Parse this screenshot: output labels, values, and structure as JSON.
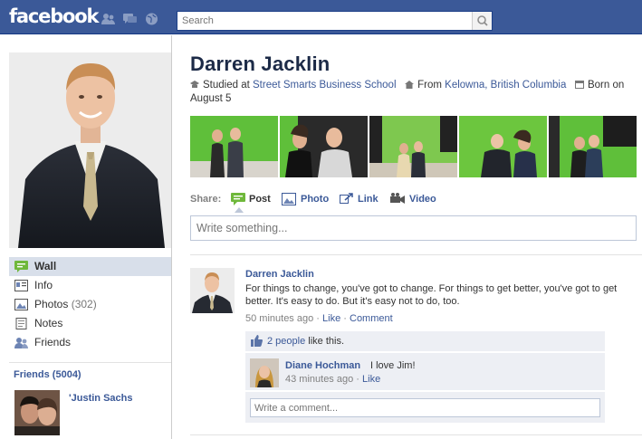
{
  "topbar": {
    "logo": "facebook",
    "search_placeholder": "Search",
    "icons": [
      "friend-requests-icon",
      "messages-icon",
      "notifications-globe-icon"
    ]
  },
  "profile": {
    "name": "Darren Jacklin",
    "studied_label": "Studied at",
    "school": "Street Smarts Business School",
    "from_label": "From",
    "hometown": "Kelowna, British Columbia",
    "born_label": "Born on",
    "born_date": "August 5"
  },
  "nav": {
    "items": [
      {
        "label": "Wall",
        "icon": "wall-icon"
      },
      {
        "label": "Info",
        "icon": "info-icon"
      },
      {
        "label": "Photos",
        "count": "(302)",
        "icon": "photos-icon"
      },
      {
        "label": "Notes",
        "icon": "notes-icon"
      },
      {
        "label": "Friends",
        "icon": "friends-icon"
      }
    ]
  },
  "friends": {
    "heading": "Friends",
    "count": "(5004)",
    "first_friend": "'Justin Sachs"
  },
  "share": {
    "label": "Share:",
    "items": [
      {
        "label": "Post",
        "icon": "post-icon"
      },
      {
        "label": "Photo",
        "icon": "photo-icon"
      },
      {
        "label": "Link",
        "icon": "link-icon"
      },
      {
        "label": "Video",
        "icon": "video-icon"
      }
    ],
    "composer_placeholder": "Write something..."
  },
  "story": {
    "author": "Darren Jacklin",
    "text": "For things to change, you've got to change. For things to get better, you've got to get better. It's easy to do. But it's easy not to do, too.",
    "time": "50 minutes ago",
    "sep": "·",
    "like": "Like",
    "comment": "Comment",
    "likes_link": "2 people",
    "likes_suffix": "like this.",
    "comments": [
      {
        "author": "Diane Hochman",
        "text": "I love Jim!",
        "time": "43 minutes ago",
        "like": "Like"
      }
    ],
    "add_comment_placeholder": "Write a comment..."
  },
  "colors": {
    "brand": "#3b5998",
    "nav_active": "#d8dfea",
    "feedback_bg": "#edeff4"
  }
}
